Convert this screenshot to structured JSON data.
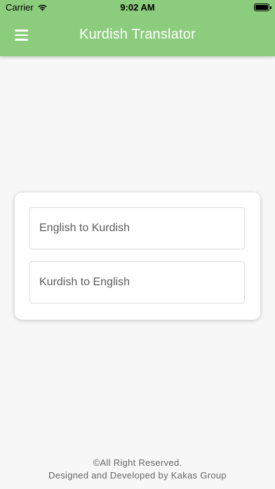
{
  "status_bar": {
    "carrier": "Carrier",
    "time": "9:02 AM"
  },
  "app_bar": {
    "title": "Kurdish Translator"
  },
  "options": [
    {
      "label": "English to Kurdish"
    },
    {
      "label": "Kurdish to English"
    }
  ],
  "footer": {
    "line1": "©All Right Reserved.",
    "line2": "Designed and Developed by Kakas Group"
  },
  "colors": {
    "app_bar": "#8ccc7d",
    "background": "#f7f7f7"
  }
}
